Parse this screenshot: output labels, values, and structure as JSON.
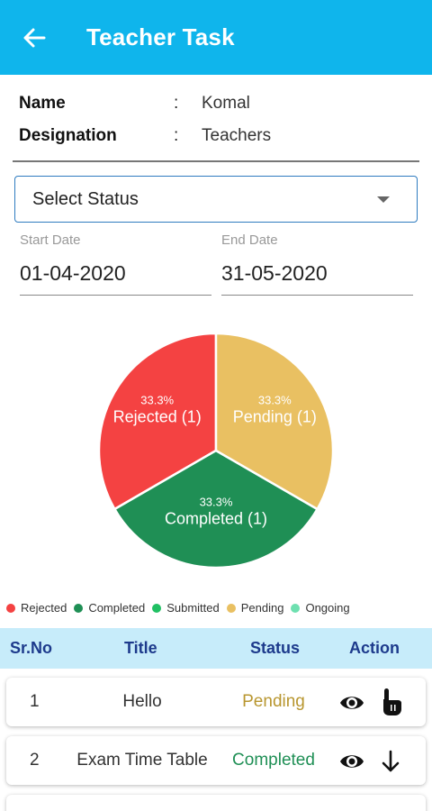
{
  "appbar": {
    "title": "Teacher Task",
    "back_icon": "arrow-left-icon"
  },
  "info": {
    "name_label": "Name",
    "name_colon": ":",
    "name_value": "Komal",
    "designation_label": "Designation",
    "designation_colon": ":",
    "designation_value": "Teachers"
  },
  "status_select": {
    "placeholder": "Select Status"
  },
  "dates": {
    "start_label": "Start Date",
    "start_value": "01-04-2020",
    "end_label": "End Date",
    "end_value": "31-05-2020"
  },
  "chart_data": {
    "type": "pie",
    "slices": [
      {
        "label": "Rejected (1)",
        "percent_label": "33.3%",
        "value": 1,
        "color": "#f44242"
      },
      {
        "label": "Completed (1)",
        "percent_label": "33.3%",
        "value": 1,
        "color": "#1f8f55"
      },
      {
        "label": "Pending (1)",
        "percent_label": "33.3%",
        "value": 1,
        "color": "#e9c062"
      }
    ],
    "legend": [
      {
        "label": "Rejected",
        "color": "#f44242"
      },
      {
        "label": "Completed",
        "color": "#1f8f55"
      },
      {
        "label": "Submitted",
        "color": "#20c063"
      },
      {
        "label": "Pending",
        "color": "#e9c062"
      },
      {
        "label": "Ongoing",
        "color": "#6ee0b0"
      }
    ]
  },
  "table": {
    "headers": {
      "srno": "Sr.No",
      "title": "Title",
      "status": "Status",
      "action": "Action"
    },
    "rows": [
      {
        "srno": "1",
        "title": "Hello",
        "status": "Pending",
        "status_color": "#b8962f",
        "icons": [
          "eye-icon",
          "tap-hand-icon"
        ]
      },
      {
        "srno": "2",
        "title": "Exam Time Table",
        "status": "Completed",
        "status_color": "#1f8f55",
        "icons": [
          "eye-icon",
          "arrow-down-icon"
        ]
      }
    ]
  },
  "colors": {
    "appbar": "#0fb5ec",
    "table_header_bg": "#c7ecfa",
    "table_header_text": "#1d3a8c"
  }
}
